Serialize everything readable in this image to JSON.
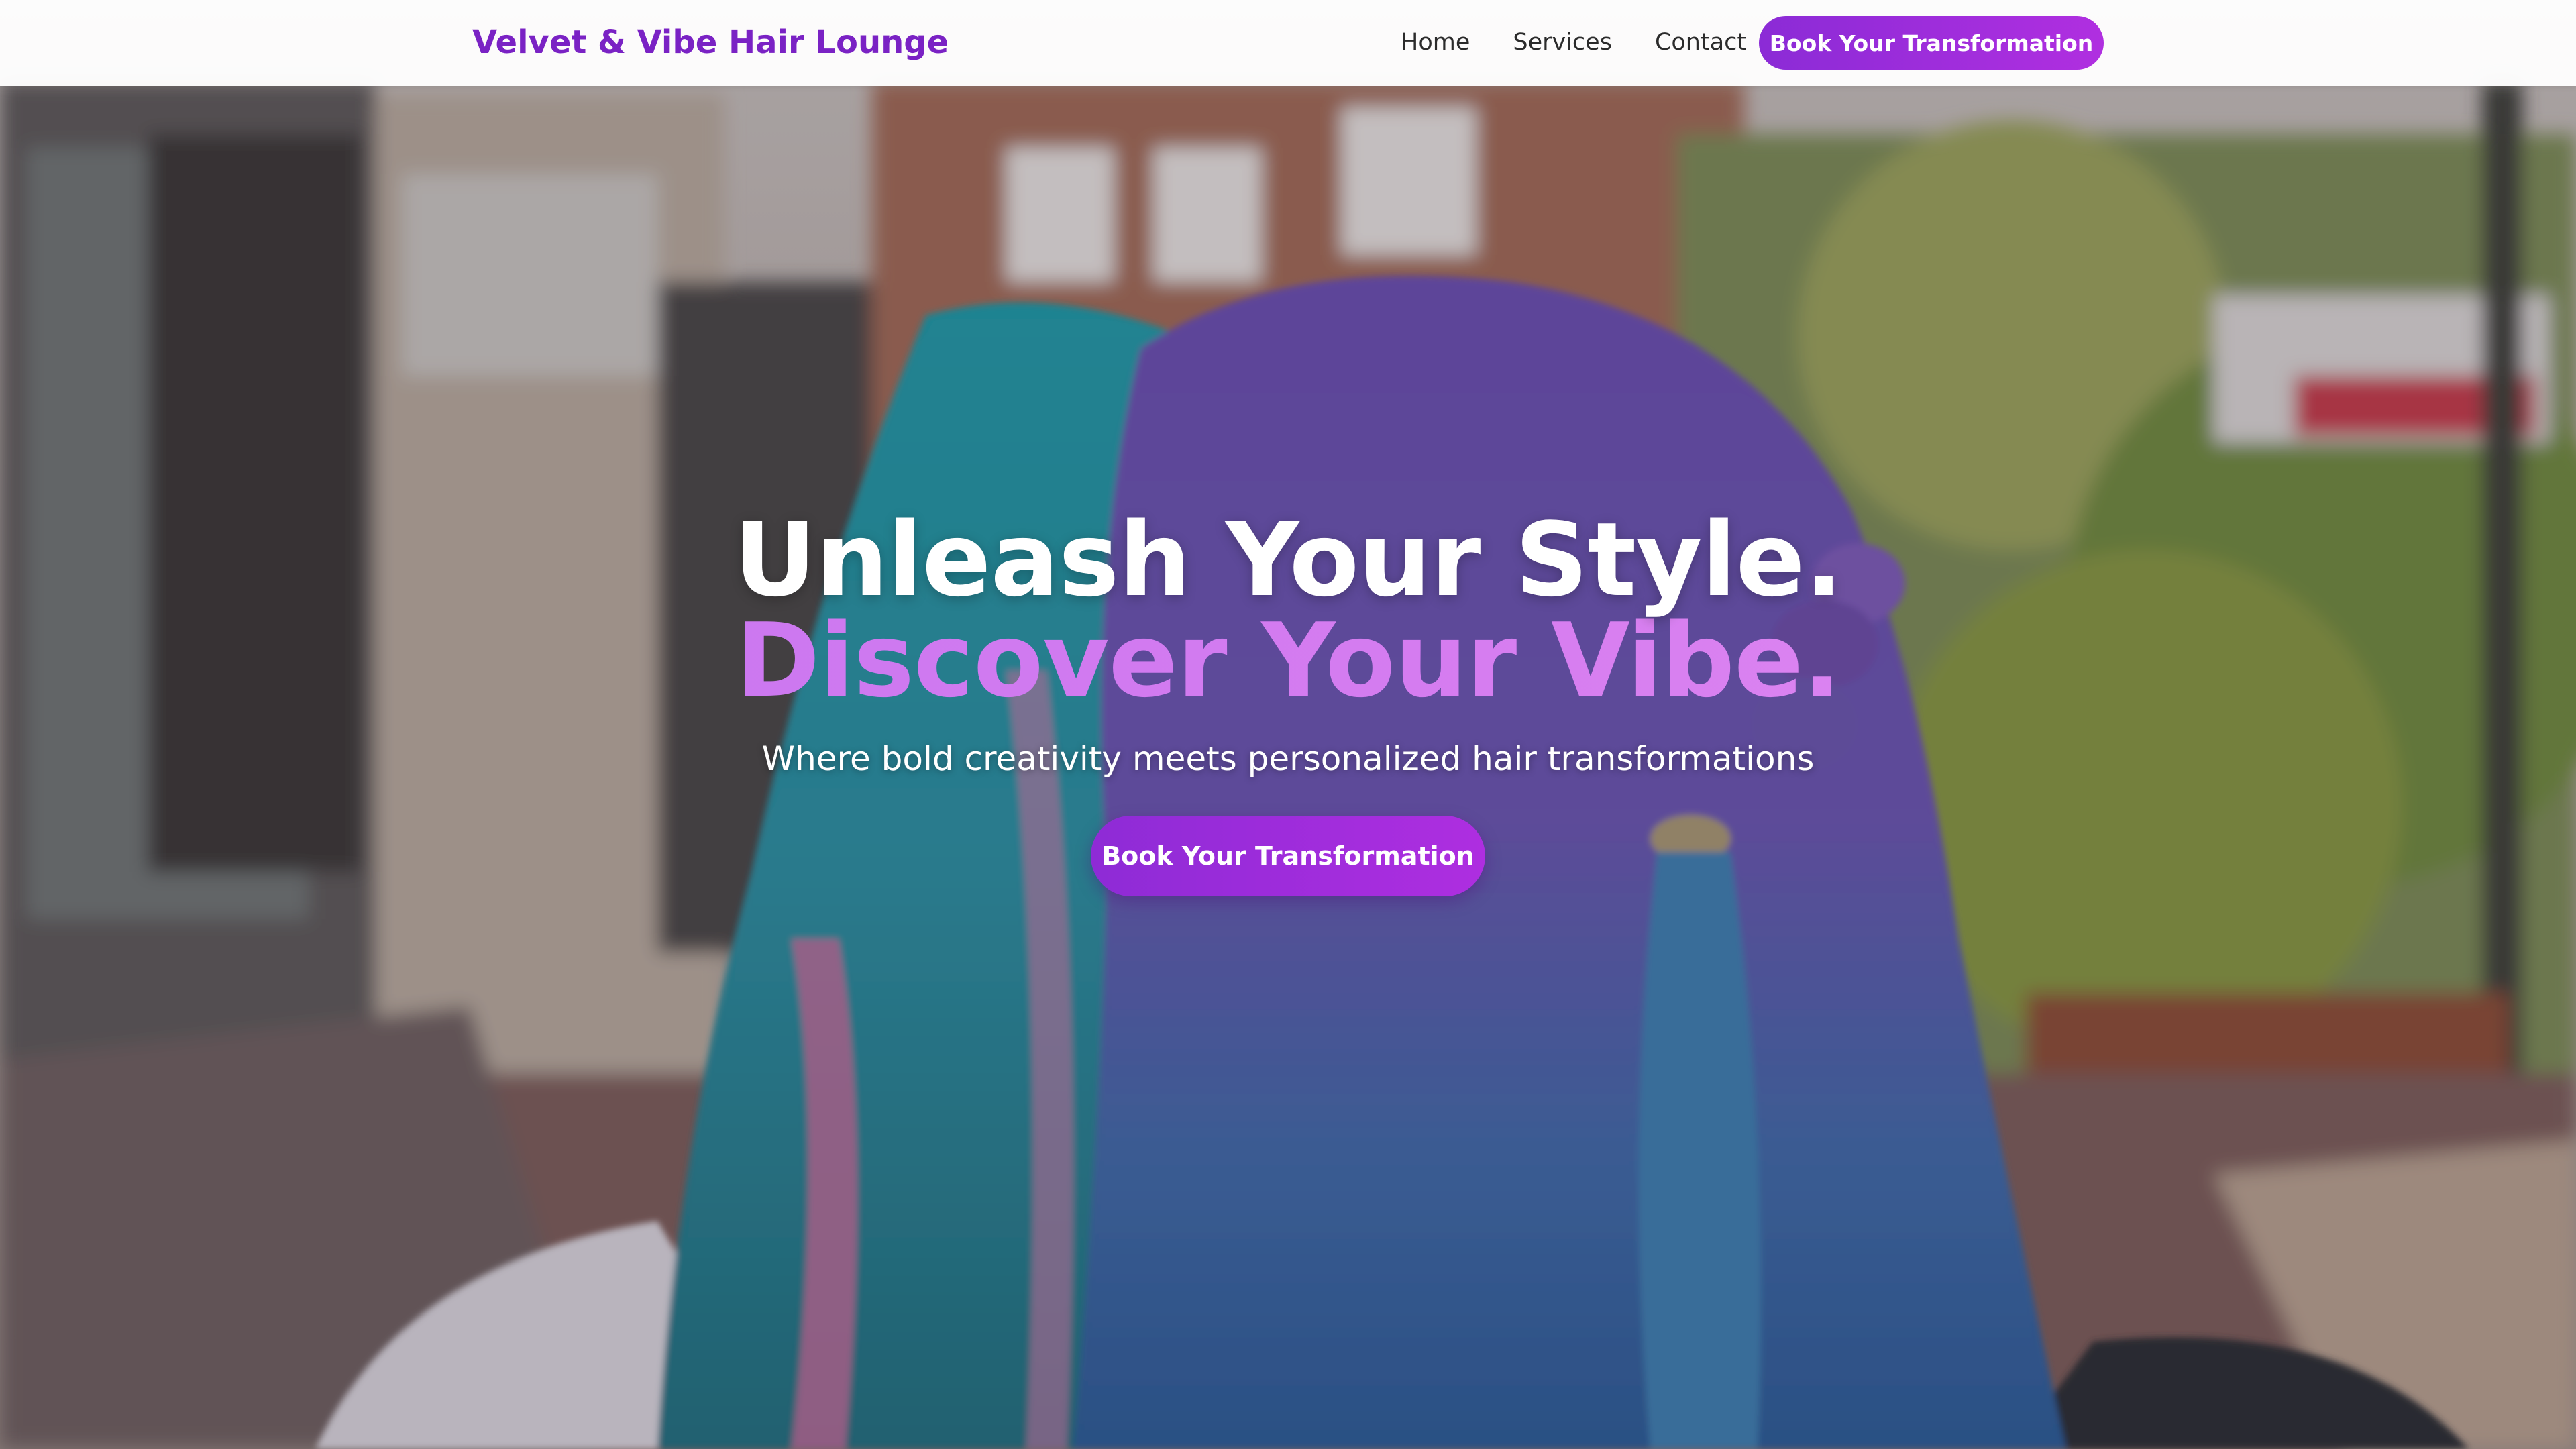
{
  "brand": {
    "name": "Velvet & Vibe Hair Lounge"
  },
  "nav": {
    "links": [
      "Home",
      "Services",
      "Contact"
    ],
    "cta_label": "Book Your Transformation"
  },
  "hero": {
    "headline_line1": "Unleash Your Style.",
    "headline_line2": "Discover Your Vibe.",
    "tagline": "Where bold creativity meets personalized hair transformations",
    "cta_label": "Book Your Transformation",
    "background_image": "Street scene with two people seen from behind, one with teal and pink hair, one with purple and blue braided hair"
  },
  "colors": {
    "brand": "#7a22c4",
    "accent": "#9b2cdc",
    "headline_gradient_start": "#c374f0",
    "headline_gradient_end": "#e48ef2"
  }
}
